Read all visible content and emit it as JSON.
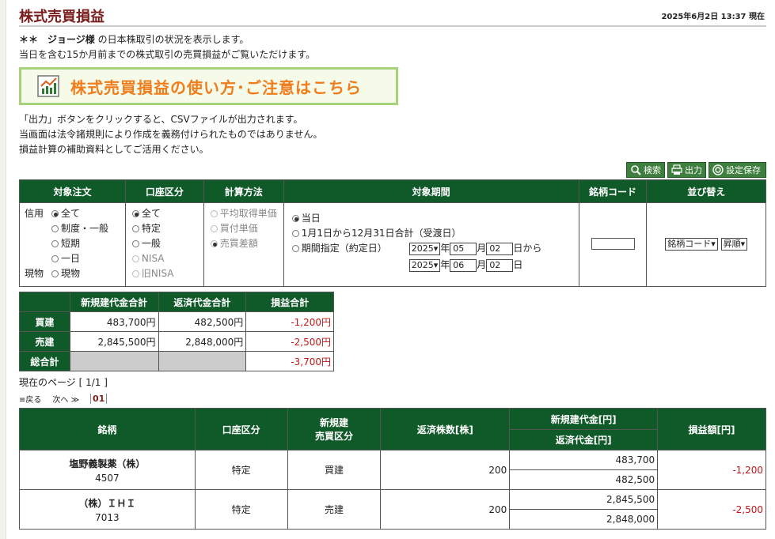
{
  "header": {
    "title": "株式売買損益",
    "timestamp": "2025年6月2日 13:37 現在"
  },
  "intro": {
    "user_prefix": "＊＊　",
    "user_name": "ジョージ様",
    "line1_suffix": " の日本株取引の状況を表示します。",
    "line2": "当日を含む15か月前までの株式取引の売買損益がご覧いただけます。"
  },
  "banner": {
    "text": "株式売買損益の使い方･ご注意はこちら"
  },
  "notes": [
    "「出力」ボタンをクリックすると、CSVファイルが出力されます。",
    "当画面は法令諸規則により作成を義務付けられたものではありません。",
    "損益計算の補助資料としてご活用ください。"
  ],
  "toolbar": {
    "search": "検索",
    "print": "出力",
    "save": "設定保存"
  },
  "conditions": {
    "headers": [
      "対象注文",
      "口座区分",
      "計算方法",
      "対象期間",
      "銘柄コード",
      "並び替え"
    ],
    "order": {
      "credit_label": "信用",
      "cash_label": "現物",
      "options": [
        "全て",
        "制度・一般",
        "短期",
        "一日",
        "現物"
      ]
    },
    "account": {
      "options": [
        "全て",
        "特定",
        "一般",
        "NISA",
        "旧NISA"
      ]
    },
    "method": {
      "options": [
        "平均取得単価",
        "買付単価",
        "売買差額"
      ]
    },
    "period": {
      "today": "当日",
      "yearly": "1月1日から12月31日合計（受渡日）",
      "range": "期間指定（約定日）",
      "from_year": "2025",
      "from_month": "05",
      "from_day": "02",
      "to_year": "2025",
      "to_month": "06",
      "to_day": "02",
      "year_unit": "年",
      "month_unit": "月",
      "day_from": "日から",
      "day_to": "日"
    },
    "sort": {
      "key": "銘柄コード",
      "order": "昇順"
    }
  },
  "summary": {
    "headers": [
      "新規建代金合計",
      "返済代金合計",
      "損益合計"
    ],
    "rows": [
      {
        "label": "買建",
        "open": "483,700円",
        "close": "482,500円",
        "pl": "-1,200円"
      },
      {
        "label": "売建",
        "open": "2,845,500円",
        "close": "2,848,000円",
        "pl": "-2,500円"
      },
      {
        "label": "総合計",
        "pl": "-3,700円"
      }
    ]
  },
  "pagination": {
    "info": "現在のページ [ 1/1 ]",
    "prev": "≡戻る",
    "next": "次へ ≫",
    "current": "01"
  },
  "detail": {
    "headers": {
      "stock": "銘柄",
      "account": "口座区分",
      "side1": "新規建",
      "side2": "売買区分",
      "qty": "返済株数[株]",
      "open": "新規建代金[円]",
      "close": "返済代金[円]",
      "pl": "損益額[円]"
    },
    "rows": [
      {
        "name": "塩野義製薬（株）",
        "code": "4507",
        "account": "特定",
        "side": "買建",
        "qty": "200",
        "open": "483,700",
        "close": "482,500",
        "pl": "-1,200"
      },
      {
        "name": "（株）ＩＨＩ",
        "code": "7013",
        "account": "特定",
        "side": "売建",
        "qty": "200",
        "open": "2,845,500",
        "close": "2,848,000",
        "pl": "-2,500"
      }
    ]
  }
}
